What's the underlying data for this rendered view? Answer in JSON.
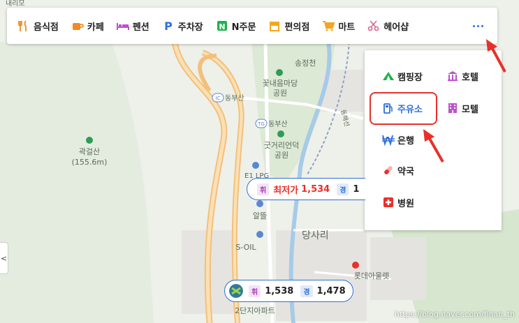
{
  "categories": [
    {
      "label": "음식점",
      "icon": "fork-knife-icon",
      "color": "#f08a24"
    },
    {
      "label": "카페",
      "icon": "coffee-cup-icon",
      "color": "#f08a24"
    },
    {
      "label": "펜션",
      "icon": "bed-icon",
      "color": "#c04fd0"
    },
    {
      "label": "주차장",
      "icon": "parking-icon",
      "color": "#2f6fdb"
    },
    {
      "label": "N주문",
      "icon": "n-order-icon",
      "color": "#1fb24a"
    },
    {
      "label": "편의점",
      "icon": "store-icon",
      "color": "#f2a81e"
    },
    {
      "label": "마트",
      "icon": "cart-icon",
      "color": "#f2a81e"
    },
    {
      "label": "헤어샵",
      "icon": "scissors-icon",
      "color": "#e06090"
    }
  ],
  "more_menu": {
    "items": [
      {
        "label": "캠핑장",
        "icon": "tent-icon",
        "color": "#1fb24a"
      },
      {
        "label": "호텔",
        "icon": "hotel-icon",
        "color": "#c04fd0"
      },
      {
        "label": "주유소",
        "icon": "fuel-pump-icon",
        "color": "#2f6fdb"
      },
      {
        "label": "모텔",
        "icon": "motel-icon",
        "color": "#c04fd0"
      },
      {
        "label": "은행",
        "icon": "won-icon",
        "color": "#2f6fdb"
      },
      {
        "label": "약국",
        "icon": "pill-icon",
        "color": "#e8302a"
      },
      {
        "label": "병원",
        "icon": "hospital-cross-icon",
        "color": "#e8302a"
      }
    ],
    "selected": "주유소"
  },
  "map_labels": {
    "top_left": "내리모",
    "station": "송정천",
    "park1": "꽃내음마당",
    "park1b": "공원",
    "ic1": "동부산",
    "tg": "동부산",
    "park2": "굿거리언덕",
    "park2b": "공원",
    "mountain": "곽걸산",
    "mountain_height": "(155.6m)",
    "brand1": "알뜰",
    "brand2": "S-OIL",
    "district": "당사리",
    "outlet": "롯데아울렛",
    "apartment": "2단지아파트",
    "road": "동해선",
    "el": "E1 LPG"
  },
  "price_pills": [
    {
      "tag_h": "휘",
      "lowest": "최저가",
      "price_h": "1,534",
      "tag_k": "경",
      "price_k": "1"
    },
    {
      "tag_h": "휘",
      "price_h": "1,538",
      "tag_k": "경",
      "price_k": "1,478"
    }
  ],
  "watermark": "https://blog.naver.com/finan_th",
  "left_handle": "<"
}
